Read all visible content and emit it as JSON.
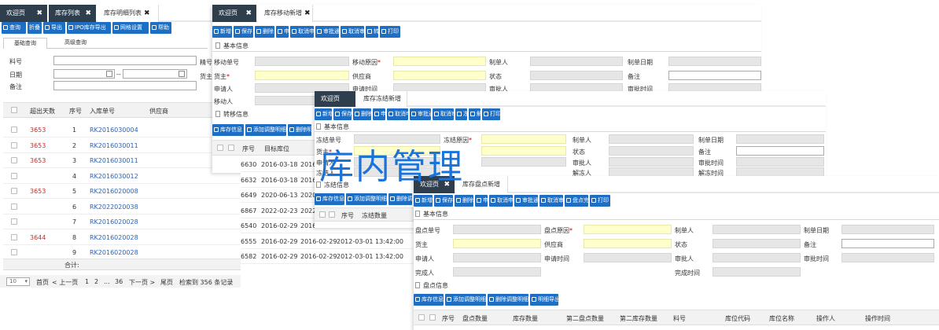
{
  "w1": {
    "tabs": [
      {
        "label": "欢迎页"
      },
      {
        "label": "库存列表"
      },
      {
        "label": "库存明细列表"
      }
    ],
    "toolbar": [
      "查询",
      "折叠",
      "导出",
      "IPO库存导出",
      "网格设置",
      "帮助"
    ],
    "query_tabs": [
      "基础查询",
      "高级查询"
    ],
    "filter_labels": {
      "item_no": "料号",
      "date": "日期",
      "note": "备注",
      "date_sep": "--",
      "cutoff_1": "精号",
      "cutoff_2": "货主"
    },
    "headers": [
      "超出天数",
      "序号",
      "入库单号",
      "供应商"
    ],
    "rows": [
      {
        "over": "3653",
        "idx": "1",
        "no": "RK2016030004"
      },
      {
        "over": "3653",
        "idx": "2",
        "no": "RK2016030011"
      },
      {
        "over": "3653",
        "idx": "3",
        "no": "RK2016030011"
      },
      {
        "over": "",
        "idx": "4",
        "no": "RK2016030012"
      },
      {
        "over": "3653",
        "idx": "5",
        "no": "RK2016020008"
      },
      {
        "over": "",
        "idx": "6",
        "no": "RK2022020038"
      },
      {
        "over": "",
        "idx": "7",
        "no": "RK2016020028"
      },
      {
        "over": "3644",
        "idx": "8",
        "no": "RK2016020028"
      },
      {
        "over": "",
        "idx": "9",
        "no": "RK2016020028"
      }
    ],
    "total_label": "合计:",
    "pager": {
      "size": "10",
      "first": "首页",
      "prev": "< 上一页",
      "p1": "1",
      "p2": "2",
      "dots": "...",
      "p36": "36",
      "next": "下一页 >",
      "last": "尾页",
      "count": "检索到 356 条记录"
    }
  },
  "w2": {
    "tabs": [
      {
        "label": "欢迎页"
      },
      {
        "label": "库存移动新增"
      }
    ],
    "toolbar": [
      "新增",
      "保存",
      "删除",
      "申请",
      "取消申请",
      "审批通过",
      "取消审批",
      "转移",
      "打印"
    ],
    "section": "基本信息",
    "labels": {
      "move_no": "移动单号",
      "reason": "移动原因",
      "creator": "制单人",
      "create_date": "制单日期",
      "owner": "货主",
      "supplier": "供应商",
      "status": "状态",
      "note": "备注",
      "applicant": "申请人",
      "apply_time": "申请时间",
      "approver": "审批人",
      "approve_time": "审批时间",
      "mover": "移动人"
    },
    "section2": "转移信息",
    "toolbar2": [
      "库存信息",
      "添加调整明细",
      "删除明"
    ],
    "headers": [
      "序号",
      "目标库位"
    ],
    "rows": [
      {
        "a": "6630",
        "b": "2016-03-18",
        "c": "2016-03-1"
      },
      {
        "a": "6632",
        "b": "2016-03-18",
        "c": "2016-03-1"
      },
      {
        "a": "6649",
        "b": "2020-06-13",
        "c": "2020-06-1"
      },
      {
        "a": "6867",
        "b": "2022-02-23",
        "c": "2022-02-2"
      },
      {
        "a": "6540",
        "b": "2016-02-29",
        "c": "2016-02-2"
      },
      {
        "a": "6555",
        "b": "2016-02-29",
        "c": "2016-02-29",
        "d": "2012-03-01 13:42:00"
      },
      {
        "a": "6582",
        "b": "2016-02-29",
        "c": "2016-02-29",
        "d": "2012-03-01 13:42:00"
      }
    ]
  },
  "w3": {
    "tabs": [
      {
        "label": "欢迎页"
      },
      {
        "label": "库存冻结新增"
      }
    ],
    "toolbar": [
      "新增",
      "保存",
      "删除",
      "申请",
      "取消申请",
      "审批通过",
      "取消审批",
      "冻结",
      "解冻",
      "打印"
    ],
    "section": "基本信息",
    "labels": {
      "freeze_no": "冻结单号",
      "reason": "冻结原因",
      "creator": "制单人",
      "create_date": "制单日期",
      "owner": "货主",
      "status": "状态",
      "note": "备注",
      "applicant": "申请人",
      "approver": "审批人",
      "approve_time": "审批时间",
      "freezer": "冻结人",
      "unfreezer": "解冻人",
      "unfreeze_time": "解冻时间"
    },
    "section2": "冻结信息",
    "toolbar2": [
      "库存信息",
      "添加调整明细",
      "删除调"
    ],
    "headers": [
      "序号",
      "冻结数量"
    ]
  },
  "w4": {
    "tabs": [
      {
        "label": "欢迎页"
      },
      {
        "label": "库存盘点新增"
      }
    ],
    "toolbar": [
      "新增",
      "保存",
      "删除",
      "申请",
      "取消申请",
      "审批通过",
      "取消审批",
      "盘点完成",
      "打印"
    ],
    "section": "基本信息",
    "labels": {
      "count_no": "盘点单号",
      "reason": "盘点原因",
      "creator": "制单人",
      "create_date": "制单日期",
      "owner": "货主",
      "supplier": "供应商",
      "status": "状态",
      "note": "备注",
      "applicant": "申请人",
      "apply_time": "申请时间",
      "approver": "审批人",
      "approve_time": "审批时间",
      "finisher": "完成人",
      "finish_time": "完成时间"
    },
    "section2": "盘点信息",
    "toolbar2": [
      "库存信息",
      "添加调整明细",
      "删除调整明细",
      "明细导出"
    ],
    "headers": [
      "序号",
      "盘点数量",
      "库存数量",
      "第二盘点数量",
      "第二库存数量",
      "料号",
      "库位代码",
      "库位名称",
      "操作人",
      "操作时间"
    ]
  },
  "overlay_text": "库内管理",
  "colors": {
    "accent": "#1e6fc3",
    "tab_dark": "#2f3e4d",
    "required_field": "#ffffcc",
    "overlay": "#1a73d9"
  }
}
